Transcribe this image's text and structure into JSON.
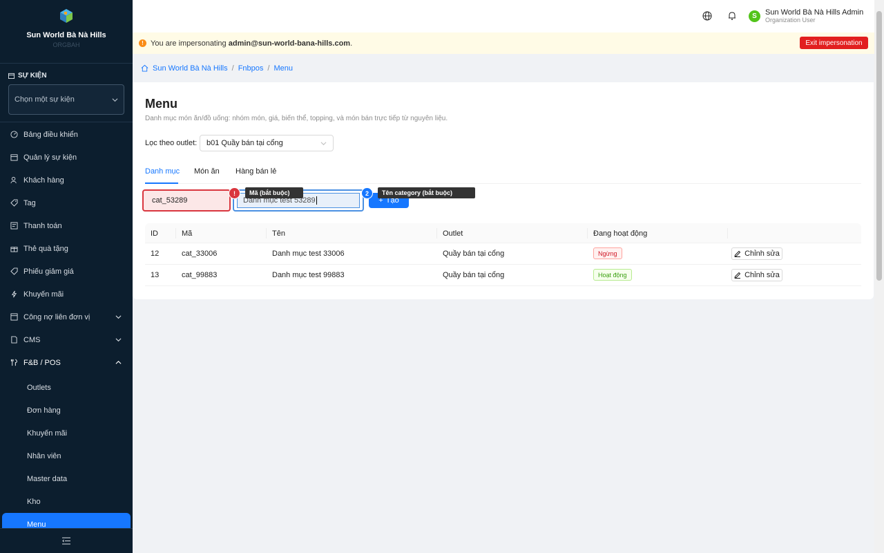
{
  "sidebar": {
    "brand_name": "Sun World Bà Nà Hills",
    "brand_sub": "ORGBAH",
    "event_label": "SỰ KIỆN",
    "event_placeholder": "Chọn một sự kiện",
    "items": [
      {
        "label": "Bảng điều khiển",
        "icon": "dashboard-icon"
      },
      {
        "label": "Quản lý sự kiện",
        "icon": "calendar-icon"
      },
      {
        "label": "Khách hàng",
        "icon": "user-icon"
      },
      {
        "label": "Tag",
        "icon": "tag-icon"
      },
      {
        "label": "Thanh toán",
        "icon": "payment-icon"
      },
      {
        "label": "Thẻ quà tặng",
        "icon": "gift-icon"
      },
      {
        "label": "Phiếu giảm giá",
        "icon": "coupon-icon"
      },
      {
        "label": "Khuyến mãi",
        "icon": "bolt-icon"
      },
      {
        "label": "Công nợ liên đơn vị",
        "icon": "ledger-icon"
      },
      {
        "label": "CMS",
        "icon": "document-icon"
      },
      {
        "label": "F&B / POS",
        "icon": "fnb-icon"
      }
    ],
    "sub_items": [
      "Outlets",
      "Đơn hàng",
      "Khuyến mãi",
      "Nhân viên",
      "Master data",
      "Kho",
      "Menu"
    ]
  },
  "header": {
    "user_name": "Sun World Bà Nà Hills Admin",
    "user_role": "Organization User",
    "avatar_letter": "S"
  },
  "impersonation": {
    "prefix": "You are impersonating",
    "email": "admin@sun-world-bana-hills.com",
    "suffix": ".",
    "exit_label": "Exit impersonation"
  },
  "breadcrumb": [
    "Sun World Bà Nà Hills",
    "Fnbpos",
    "Menu"
  ],
  "page": {
    "title": "Menu",
    "description": "Danh mục món ăn/đồ uống: nhóm món, giá, biến thể, topping, và món bán trực tiếp từ nguyên liệu.",
    "filter_label": "Lọc theo outlet:",
    "filter_value": "b01 Quầy bán tại cổng",
    "tabs": [
      "Danh mục",
      "Món ăn",
      "Hàng bán lẻ"
    ]
  },
  "form": {
    "code_value": "cat_53289",
    "name_value": "Danh mục test 53289",
    "create_label": "Tạo",
    "tip_code": "Mã (bắt buộc)",
    "tip_name": "Tên category (bắt buộc)",
    "badge_1": "!",
    "badge_2": "2"
  },
  "table": {
    "headers": [
      "ID",
      "Mã",
      "Tên",
      "Outlet",
      "Đang hoạt động"
    ],
    "edit_label": "Chỉnh sửa",
    "rows": [
      {
        "id": "12",
        "code": "cat_33006",
        "name": "Danh mục test 33006",
        "outlet": "Quầy bán tại cổng",
        "status": "Ngừng"
      },
      {
        "id": "13",
        "code": "cat_99883",
        "name": "Danh mục test 99883",
        "outlet": "Quầy bán tại cổng",
        "status": "Hoạt động"
      }
    ]
  },
  "colors": {
    "accent": "#1677ff",
    "sidebar_bg": "#0c1e2e",
    "danger": "#e21f1f"
  }
}
